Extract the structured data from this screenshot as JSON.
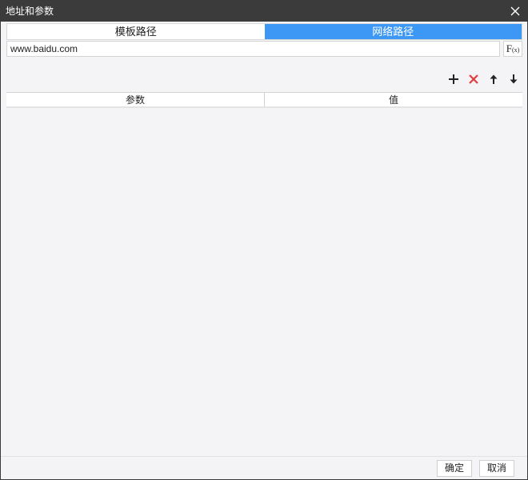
{
  "window": {
    "title": "地址和参数"
  },
  "tabs": [
    {
      "label": "模板路径",
      "active": false
    },
    {
      "label": "网络路径",
      "active": true
    }
  ],
  "url": {
    "value": "www.baidu.com",
    "formula_label": "F",
    "formula_sub": "(x)"
  },
  "toolbar": {
    "icons": [
      "add-icon",
      "delete-icon",
      "move-up-icon",
      "move-down-icon"
    ],
    "add_color": "#222222",
    "delete_color": "#e23b3b"
  },
  "table": {
    "columns": [
      "参数",
      "值"
    ],
    "rows": []
  },
  "footer": {
    "ok_label": "确定",
    "cancel_label": "取消"
  },
  "colors": {
    "title_bar": "#3b3b3b",
    "active_tab": "#3d98f5",
    "body": "#f4f4f6"
  }
}
